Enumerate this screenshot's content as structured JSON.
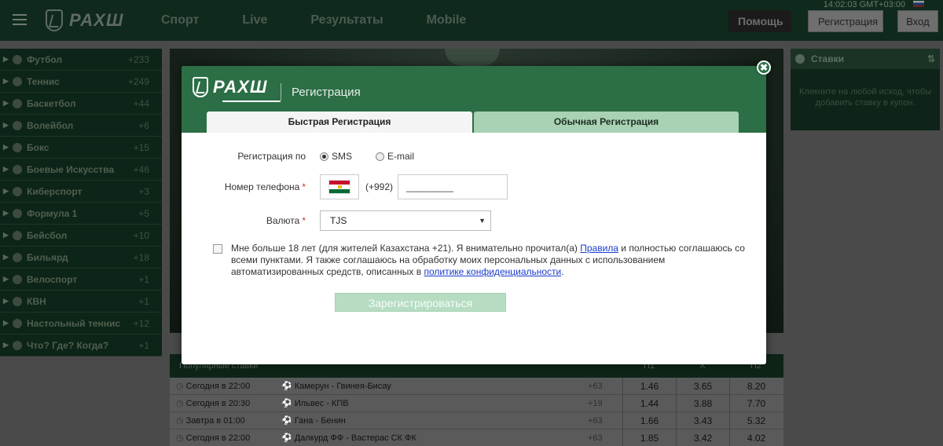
{
  "header": {
    "clock": "14:02:03 GMT+03:00",
    "logo": "РАХШ",
    "nav": [
      "Спорт",
      "Live",
      "Результаты",
      "Mobile"
    ],
    "help": "Помощь",
    "register": "Регистрация",
    "login": "Вход"
  },
  "sidebar": {
    "items": [
      {
        "label": "Футбол",
        "count": "+233"
      },
      {
        "label": "Теннис",
        "count": "+249"
      },
      {
        "label": "Баскетбол",
        "count": "+44"
      },
      {
        "label": "Волейбол",
        "count": "+6"
      },
      {
        "label": "Бокс",
        "count": "+15"
      },
      {
        "label": "Боевые Искусства",
        "count": "+46"
      },
      {
        "label": "Киберспорт",
        "count": "+3"
      },
      {
        "label": "Формула 1",
        "count": "+5"
      },
      {
        "label": "Бейсбол",
        "count": "+10"
      },
      {
        "label": "Бильярд",
        "count": "+18"
      },
      {
        "label": "Велоспорт",
        "count": "+1"
      },
      {
        "label": "КВН",
        "count": "+1"
      },
      {
        "label": "Настольный теннис",
        "count": "+12"
      },
      {
        "label": "Что? Где? Когда?",
        "count": "+1"
      }
    ]
  },
  "bets": {
    "title": "Ставки",
    "hint": "Кликните на любой исход, чтобы добавить ставку в купон."
  },
  "events": {
    "header": "Популярные ставки",
    "cols": [
      "П1",
      "X",
      "П2"
    ],
    "rows": [
      {
        "time": "Сегодня в 22:00",
        "match": "Камерун - Гвинея-Бисау",
        "more": "+63",
        "odds": [
          "1.46",
          "3.65",
          "8.20"
        ]
      },
      {
        "time": "Сегодня в 20:30",
        "match": "Ильвес - КПВ",
        "more": "+19",
        "odds": [
          "1.44",
          "3.88",
          "7.70"
        ]
      },
      {
        "time": "Завтра в 01:00",
        "match": "Гана - Бенин",
        "more": "+63",
        "odds": [
          "1.66",
          "3.43",
          "5.32"
        ]
      },
      {
        "time": "Сегодня в 22:00",
        "match": "Далкурд ФФ - Вастерас СК ФК",
        "more": "+63",
        "odds": [
          "1.85",
          "3.42",
          "4.02"
        ]
      }
    ]
  },
  "modal": {
    "logo": "РАХШ",
    "title": "Регистрация",
    "tabs": {
      "quick": "Быстрая Регистрация",
      "normal": "Обычная Регистрация"
    },
    "close": "✖",
    "reg_by": {
      "label": "Регистрация по",
      "sms": "SMS",
      "email": "E-mail"
    },
    "phone": {
      "label": "Номер телефона",
      "code": "(+992)",
      "value": "_________"
    },
    "currency": {
      "label": "Валюта",
      "value": "TJS"
    },
    "required_mark": "*",
    "agreement": {
      "part1": "Мне больше 18 лет (для жителей Казахстана +21). Я внимательно прочитал(а) ",
      "rules_link": "Правила",
      "part2": " и полностью соглашаюсь со всеми пунктами. Я также соглашаюсь на обработку моих персональных данных с использованием автоматизированных средств, описанных в ",
      "privacy_link": "политике конфиденциальности",
      "part3": "."
    },
    "submit": "Зарегистрироваться"
  }
}
